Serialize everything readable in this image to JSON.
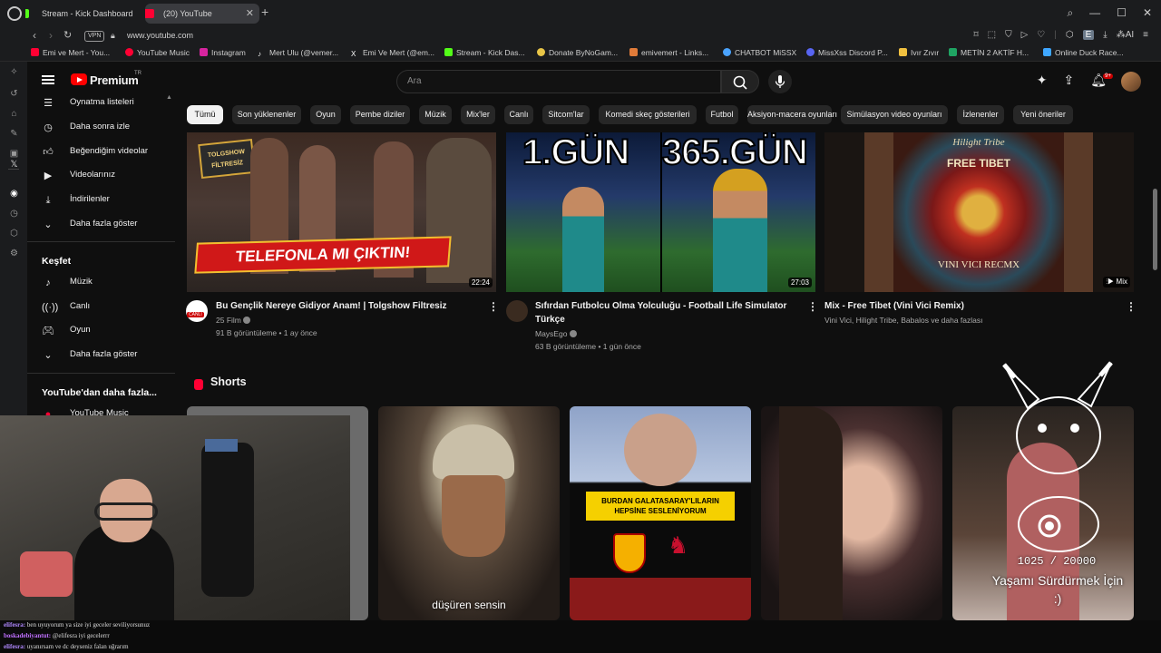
{
  "browser": {
    "tabs": [
      {
        "label": "Stream - Kick Dashboard"
      },
      {
        "label": "(20) YouTube"
      }
    ],
    "address": {
      "vpn": "VPN",
      "url": "www.youtube.com"
    },
    "bookmarks": [
      {
        "label": "Emi ve Mert - You...",
        "color": "#ff0033"
      },
      {
        "label": "YouTube Music",
        "color": "#ff0033"
      },
      {
        "label": "Instagram",
        "color": "#d6249f"
      },
      {
        "label": "Mert Ulu (@vemer...",
        "color": "#ffffff"
      },
      {
        "label": "Emi Ve Mert (@em...",
        "color": "#ffffff"
      },
      {
        "label": "Stream - Kick Das...",
        "color": "#53fc18"
      },
      {
        "label": "Donate ByNoGam...",
        "color": "#e8c547"
      },
      {
        "label": "emivemert - Links...",
        "color": "#e07b39"
      },
      {
        "label": "CHATBOT MiSSX",
        "color": "#4aa3ff"
      },
      {
        "label": "MissXss Discord P...",
        "color": "#5865f2"
      },
      {
        "label": "Ivır Zıvır",
        "color": "#f0c040"
      },
      {
        "label": "METİN 2 AKTİF H...",
        "color": "#1fa463"
      },
      {
        "label": "Online Duck Race...",
        "color": "#3ea6ff"
      }
    ]
  },
  "youtube": {
    "logo": "Premium",
    "region": "TR",
    "search_placeholder": "Ara",
    "notification_count": "9+",
    "sidebar": {
      "items": [
        {
          "label": "Oynatma listeleri",
          "icon": "playlist-icon"
        },
        {
          "label": "Daha sonra izle",
          "icon": "clock-icon"
        },
        {
          "label": "Beğendiğim videolar",
          "icon": "thumb-up-icon"
        },
        {
          "label": "Videolarınız",
          "icon": "video-icon"
        },
        {
          "label": "İndirilenler",
          "icon": "download-icon"
        },
        {
          "label": "Daha fazla göster",
          "icon": "chevron-down-icon"
        }
      ],
      "explore_heading": "Keşfet",
      "explore": [
        {
          "label": "Müzik",
          "icon": "music-icon"
        },
        {
          "label": "Canlı",
          "icon": "live-icon"
        },
        {
          "label": "Oyun",
          "icon": "gaming-icon"
        },
        {
          "label": "Daha fazla göster",
          "icon": "chevron-down-icon"
        }
      ],
      "more_heading": "YouTube'dan daha fazla...",
      "more_item": "YouTube Music"
    },
    "chips": [
      "Tümü",
      "Son yüklenenler",
      "Oyun",
      "Pembe diziler",
      "Müzik",
      "Mix'ler",
      "Canlı",
      "Sitcom'lar",
      "Komedi skeç gösterileri",
      "Futbol",
      "Aksiyon-macera oyunları",
      "Simülasyon video oyunları",
      "İzlenenler",
      "Yeni öneriler"
    ],
    "videos": [
      {
        "title": "Bu Gençlik Nereye Gidiyor Anam! | Tolgshow Filtresiz",
        "channel": "25 Film",
        "meta": "91 B görüntüleme • 1 ay önce",
        "duration": "22:24",
        "thumb_text": "TELEFONLA MI ÇIKTIN!",
        "thumb_tag": "TOLGSHOW FİLTRESİZ",
        "avatar_text": "CANLI"
      },
      {
        "title": "Sıfırdan Futbolcu Olma Yolculuğu - Football Life Simulator Türkçe",
        "channel": "MaysEgo",
        "meta": "63 B görüntüleme • 1 gün önce",
        "duration": "27:03",
        "thumb_left": "1.GÜN",
        "thumb_right": "365.GÜN"
      },
      {
        "title": "Mix - Free Tibet (Vini Vici Remix)",
        "channel": "Vini Vici, Hilight Tribe, Babalos ve daha fazlası",
        "duration": "Mix",
        "thumb_top": "FREE TIBET",
        "thumb_brand": "Hilight Tribe",
        "thumb_bottom": "VINI VICI RECMX"
      }
    ],
    "shorts_heading": "Shorts",
    "shorts": [
      {
        "caption": ""
      },
      {
        "caption": "düşüren sensin"
      },
      {
        "caption": "BURDAN GALATASARAY'LILARIN HEPSİNE SESLENİYORUM"
      },
      {
        "caption": ""
      },
      {
        "caption": ""
      }
    ]
  },
  "overlay": {
    "counter": "1025 / 20000",
    "goal": "Yaşamı Sürdürmek İçin :)"
  },
  "chat": [
    {
      "user": "elifesra:",
      "text": "ben uyuyorum ya size iyi geceler seviliyorsunuz"
    },
    {
      "user": "boskadebiyantut:",
      "text": "@elifesra iyi gecelerrr"
    },
    {
      "user": "elifesra:",
      "text": "uyanırsam ve dc deyseniz falan uğrarım"
    }
  ]
}
